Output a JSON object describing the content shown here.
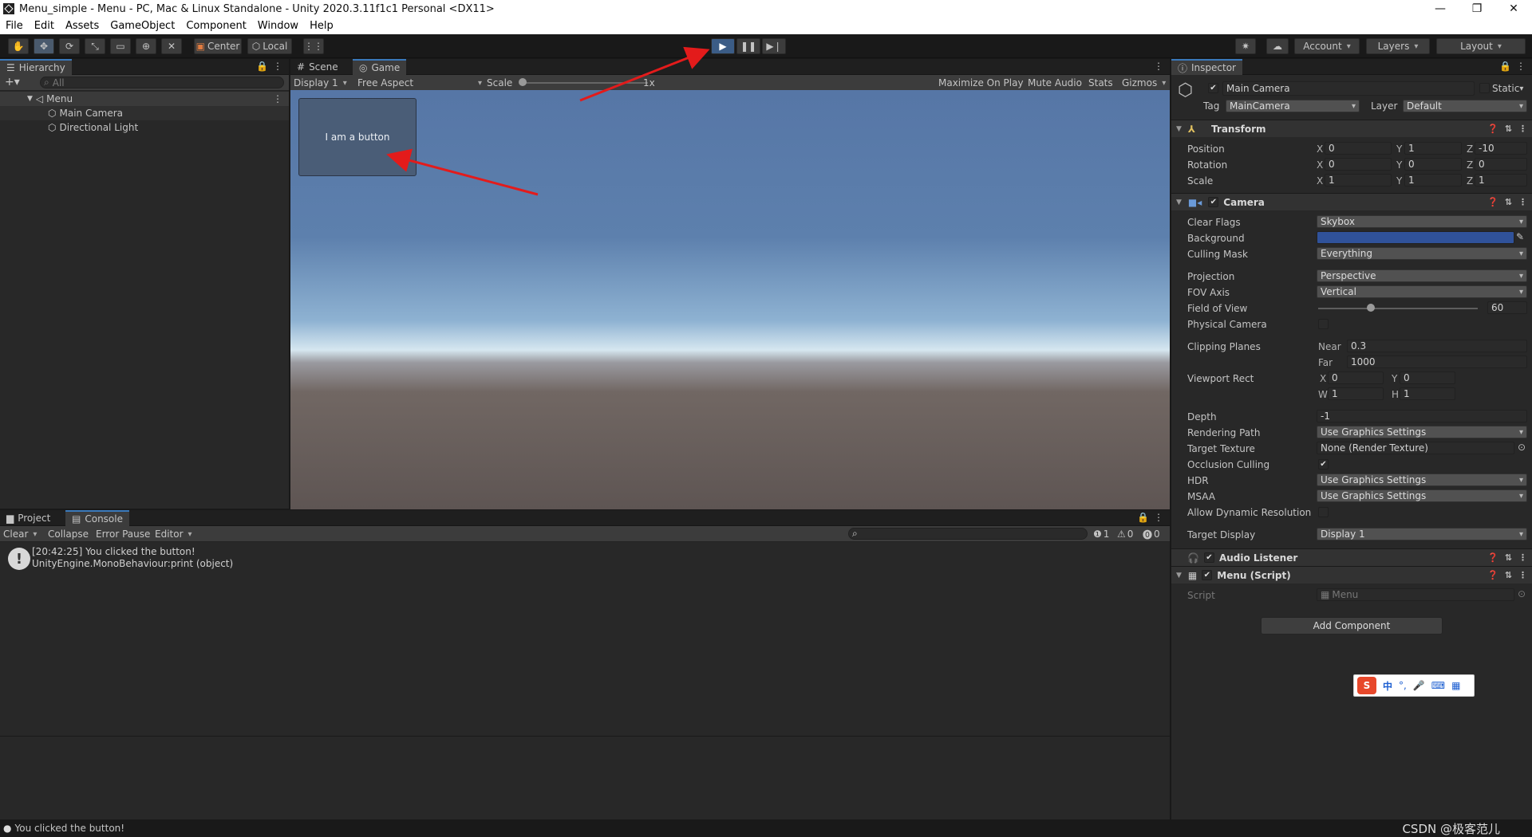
{
  "window": {
    "title": "Menu_simple - Menu - PC, Mac & Linux Standalone - Unity 2020.3.11f1c1 Personal <DX11>"
  },
  "menu": [
    "File",
    "Edit",
    "Assets",
    "GameObject",
    "Component",
    "Window",
    "Help"
  ],
  "toolbar": {
    "center": "Center",
    "local": "Local",
    "account": "Account",
    "layers": "Layers",
    "layout": "Layout"
  },
  "hierarchy": {
    "tab": "Hierarchy",
    "search_placeholder": "All",
    "scene": "Menu",
    "items": [
      "Main Camera",
      "Directional Light"
    ]
  },
  "sceneview": {
    "tab_scene": "Scene",
    "tab_game": "Game",
    "display": "Display 1",
    "aspect": "Free Aspect",
    "scale_label": "Scale",
    "scale_value": "1x",
    "maximize": "Maximize On Play",
    "mute": "Mute Audio",
    "stats": "Stats",
    "gizmos": "Gizmos",
    "button_text": "I am a button"
  },
  "console": {
    "tab_project": "Project",
    "tab_console": "Console",
    "clear": "Clear",
    "collapse": "Collapse",
    "error_pause": "Error Pause",
    "editor": "Editor",
    "log_count": "1",
    "warn_count": "0",
    "err_count": "0",
    "entry_line1": "[20:42:25] You clicked the button!",
    "entry_line2": "UnityEngine.MonoBehaviour:print (object)"
  },
  "statusbar": {
    "message": "You clicked the button!",
    "watermark": "CSDN @极客范儿"
  },
  "inspector": {
    "tab": "Inspector",
    "object_name": "Main Camera",
    "static": "Static",
    "tag_label": "Tag",
    "tag": "MainCamera",
    "layer_label": "Layer",
    "layer": "Default",
    "transform": {
      "title": "Transform",
      "rows": [
        {
          "label": "Position",
          "x": "0",
          "y": "1",
          "z": "-10"
        },
        {
          "label": "Rotation",
          "x": "0",
          "y": "0",
          "z": "0"
        },
        {
          "label": "Scale",
          "x": "1",
          "y": "1",
          "z": "1"
        }
      ]
    },
    "camera": {
      "title": "Camera",
      "clear_flags": {
        "label": "Clear Flags",
        "value": "Skybox"
      },
      "background": {
        "label": "Background",
        "color": "#30529a"
      },
      "culling_mask": {
        "label": "Culling Mask",
        "value": "Everything"
      },
      "projection": {
        "label": "Projection",
        "value": "Perspective"
      },
      "fov_axis": {
        "label": "FOV Axis",
        "value": "Vertical"
      },
      "fov": {
        "label": "Field of View",
        "value": "60"
      },
      "physical": {
        "label": "Physical Camera"
      },
      "clipping": {
        "label": "Clipping Planes",
        "near_label": "Near",
        "near": "0.3",
        "far_label": "Far",
        "far": "1000"
      },
      "viewport": {
        "label": "Viewport Rect",
        "x": "0",
        "y": "0",
        "w": "1",
        "h": "1"
      },
      "depth": {
        "label": "Depth",
        "value": "-1"
      },
      "rendering_path": {
        "label": "Rendering Path",
        "value": "Use Graphics Settings"
      },
      "target_texture": {
        "label": "Target Texture",
        "value": "None (Render Texture)"
      },
      "occlusion": {
        "label": "Occlusion Culling"
      },
      "hdr": {
        "label": "HDR",
        "value": "Use Graphics Settings"
      },
      "msaa": {
        "label": "MSAA",
        "value": "Use Graphics Settings"
      },
      "dynres": {
        "label": "Allow Dynamic Resolution"
      },
      "target_display": {
        "label": "Target Display",
        "value": "Display 1"
      }
    },
    "audio_listener": "Audio Listener",
    "menu_script": {
      "title": "Menu (Script)",
      "script_label": "Script",
      "script_value": "Menu"
    },
    "add_component": "Add Component"
  },
  "ime": {
    "lang": "中"
  }
}
